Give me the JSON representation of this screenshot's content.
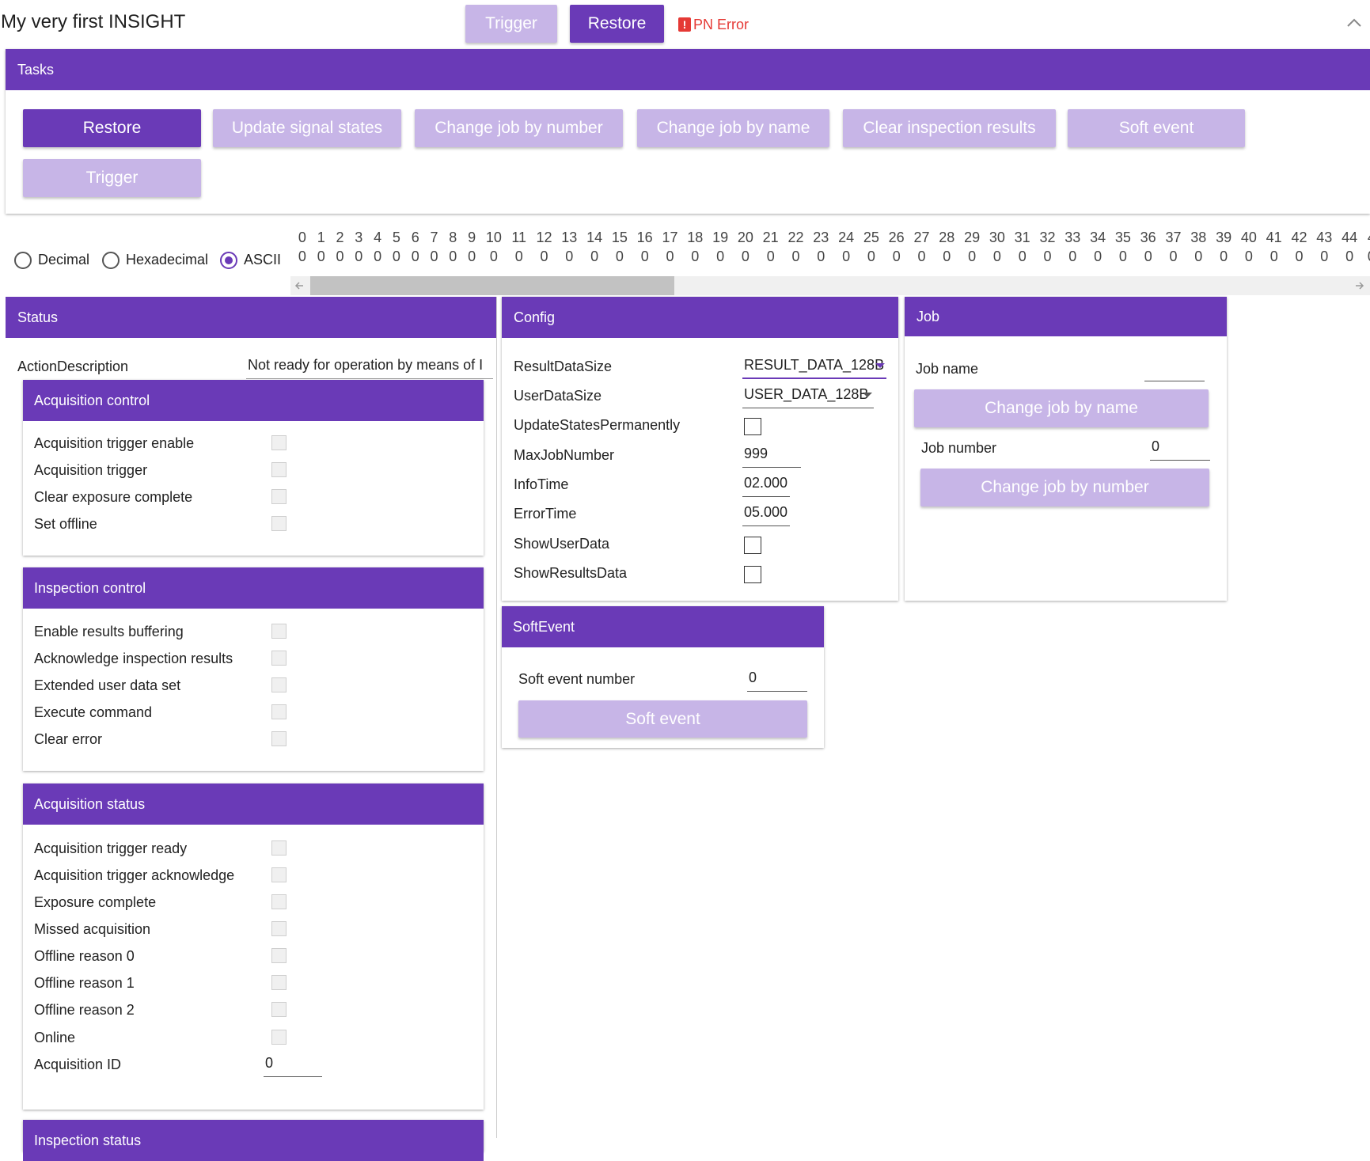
{
  "header": {
    "title": "My very first INSIGHT",
    "trigger_label": "Trigger",
    "restore_label": "Restore",
    "error_icon_glyph": "!",
    "error_text": "PN Error",
    "collapse_icon": "chevron-up-icon"
  },
  "tasks": {
    "title": "Tasks",
    "buttons": [
      "Restore",
      "Update signal states",
      "Change job by number",
      "Change job by name",
      "Clear inspection results",
      "Soft event",
      "Trigger"
    ]
  },
  "format": {
    "options": [
      "Decimal",
      "Hexadecimal",
      "ASCII"
    ],
    "selected": "ASCII"
  },
  "byte_indices": [
    "0",
    "1",
    "2",
    "3",
    "4",
    "5",
    "6",
    "7",
    "8",
    "9",
    "10",
    "11",
    "12",
    "13",
    "14",
    "15",
    "16",
    "17",
    "18",
    "19",
    "20",
    "21",
    "22",
    "23",
    "24",
    "25",
    "26",
    "27",
    "28",
    "29",
    "30",
    "31",
    "32",
    "33",
    "34",
    "35",
    "36",
    "37",
    "38",
    "39",
    "40",
    "41",
    "42",
    "43",
    "44",
    "4"
  ],
  "byte_values": [
    "0",
    "0",
    "0",
    "0",
    "0",
    "0",
    "0",
    "0",
    "0",
    "0",
    "0",
    "0",
    "0",
    "0",
    "0",
    "0",
    "0",
    "0",
    "0",
    "0",
    "0",
    "0",
    "0",
    "0",
    "0",
    "0",
    "0",
    "0",
    "0",
    "0",
    "0",
    "0",
    "0",
    "0",
    "0",
    "0",
    "0",
    "0",
    "0",
    "0",
    "0",
    "0",
    "0",
    "0",
    "0",
    "0"
  ],
  "status": {
    "title": "Status",
    "action_label": "ActionDescription",
    "action_value": "Not ready for operation by means of I",
    "acq_control": {
      "title": "Acquisition control",
      "items": [
        "Acquisition trigger enable",
        "Acquisition trigger",
        "Clear exposure complete",
        "Set offline"
      ]
    },
    "insp_control": {
      "title": "Inspection control",
      "items": [
        "Enable results buffering",
        "Acknowledge inspection results",
        "Extended user data set",
        "Execute command",
        "Clear error"
      ]
    },
    "acq_status": {
      "title": "Acquisition status",
      "items": [
        "Acquisition trigger ready",
        "Acquisition trigger acknowledge",
        "Exposure complete",
        "Missed acquisition",
        "Offline reason 0",
        "Offline reason 1",
        "Offline reason 2",
        "Online"
      ],
      "id_label": "Acquisition ID",
      "id_value": "0"
    },
    "next_title": "Inspection status"
  },
  "config": {
    "title": "Config",
    "result_label": "ResultDataSize",
    "result_value": "RESULT_DATA_128B",
    "user_label": "UserDataSize",
    "user_value": "USER_DATA_128B",
    "update_label": "UpdateStatesPermanently",
    "maxjob_label": "MaxJobNumber",
    "maxjob_value": "999",
    "info_label": "InfoTime",
    "info_value": "02.000",
    "error_label": "ErrorTime",
    "error_value": "05.000",
    "showuser_label": "ShowUserData",
    "showresults_label": "ShowResultsData"
  },
  "job": {
    "title": "Job",
    "name_label": "Job name",
    "name_value": "",
    "change_name_label": "Change job by name",
    "number_label": "Job number",
    "number_value": "0",
    "change_number_label": "Change job by number"
  },
  "softevent": {
    "title": "SoftEvent",
    "number_label": "Soft event number",
    "number_value": "0",
    "button_label": "Soft event"
  },
  "colors": {
    "accent": "#6a3ab7",
    "accent_light": "#c7b5e7",
    "error": "#e53935"
  }
}
